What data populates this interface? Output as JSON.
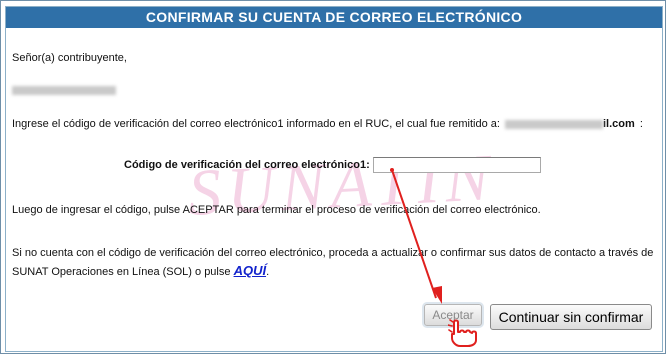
{
  "header": {
    "title": "CONFIRMAR SU CUENTA DE CORREO ELECTRÓNICO"
  },
  "greeting": "Señor(a) contribuyente,",
  "instructions": {
    "prefix": "Ingrese el código de verificación del correo electrónico1 informado en el RUC, el cual fue remitido a:",
    "email_suffix": "il.com",
    "trailing": ":"
  },
  "form": {
    "code_label": "Código de verificación del correo electrónico1:",
    "code_value": ""
  },
  "watermark": "SUNATIN",
  "after_text": "Luego de ingresar el código, pulse ACEPTAR para terminar el proceso de verificación del correo electrónico.",
  "no_code": {
    "line1": "Si no cuenta con el código de verificación del correo electrónico, proceda a actualizar o confirmar sus datos de contacto a través de",
    "line2_prefix": "SUNAT Operaciones en Línea (SOL) o pulse",
    "link": "AQUÍ",
    "line2_suffix": "."
  },
  "buttons": {
    "accept": "Aceptar",
    "continue": "Continuar sin confirmar"
  },
  "colors": {
    "header_bg": "#2f70a8",
    "arrow": "#e0201e",
    "link": "#1122cc"
  },
  "icons": [
    "red-arrow-icon",
    "pointing-hand-icon"
  ]
}
